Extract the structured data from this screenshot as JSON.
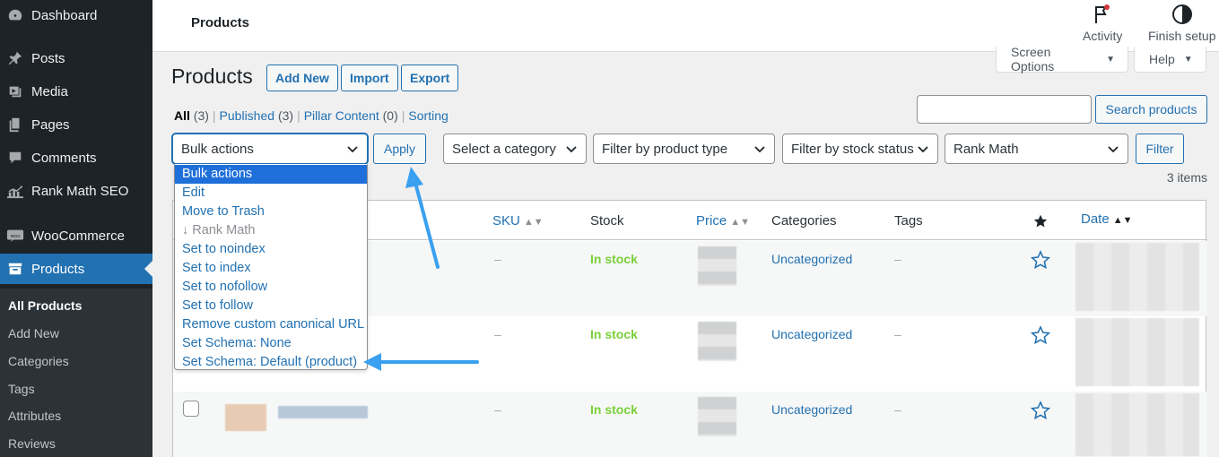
{
  "sidebar": {
    "items": [
      {
        "label": "Dashboard",
        "icon": "dashboard-icon"
      },
      {
        "label": "Posts",
        "icon": "pin-icon"
      },
      {
        "label": "Media",
        "icon": "media-icon"
      },
      {
        "label": "Pages",
        "icon": "pages-icon"
      },
      {
        "label": "Comments",
        "icon": "comment-icon"
      },
      {
        "label": "Rank Math SEO",
        "icon": "chart-icon"
      },
      {
        "label": "WooCommerce",
        "icon": "woo-icon"
      },
      {
        "label": "Products",
        "icon": "archive-icon"
      }
    ],
    "submenu": [
      "All Products",
      "Add New",
      "Categories",
      "Tags",
      "Attributes",
      "Reviews"
    ]
  },
  "topbar": {
    "title": "Products",
    "activity_label": "Activity",
    "finish_label": "Finish setup"
  },
  "screen_options_label": "Screen Options",
  "help_label": "Help",
  "heading": "Products",
  "buttons": {
    "add_new": "Add New",
    "import": "Import",
    "export": "Export"
  },
  "views": [
    {
      "label": "All",
      "count": "(3)"
    },
    {
      "label": "Published",
      "count": "(3)"
    },
    {
      "label": "Pillar Content",
      "count": "(0)"
    },
    {
      "label": "Sorting",
      "count": ""
    }
  ],
  "search_button": "Search products",
  "filters": {
    "bulk_actions": "Bulk actions",
    "apply": "Apply",
    "category": "Select a category",
    "product_type": "Filter by product type",
    "stock_status": "Filter by stock status",
    "rank_math": "Rank Math",
    "filter": "Filter"
  },
  "items_count": "3 items",
  "columns": {
    "sku": "SKU",
    "stock": "Stock",
    "price": "Price",
    "categories": "Categories",
    "tags": "Tags",
    "date": "Date"
  },
  "rows": [
    {
      "sku": "–",
      "stock": "In stock",
      "category": "Uncategorized",
      "tags": "–"
    },
    {
      "sku": "–",
      "stock": "In stock",
      "category": "Uncategorized",
      "tags": "–"
    },
    {
      "sku": "–",
      "stock": "In stock",
      "category": "Uncategorized",
      "tags": "–"
    }
  ],
  "dropdown_options": [
    "Bulk actions",
    "Edit",
    "Move to Trash",
    "↓ Rank Math",
    "Set to noindex",
    "Set to index",
    "Set to nofollow",
    "Set to follow",
    "Remove custom canonical URL",
    "Set Schema: None",
    "Set Schema: Default (product)"
  ],
  "colors": {
    "accent": "#2271b1",
    "sidebar": "#1d2327",
    "in_stock": "#7ad03a",
    "annotation_arrow": "#3aa0f0"
  }
}
